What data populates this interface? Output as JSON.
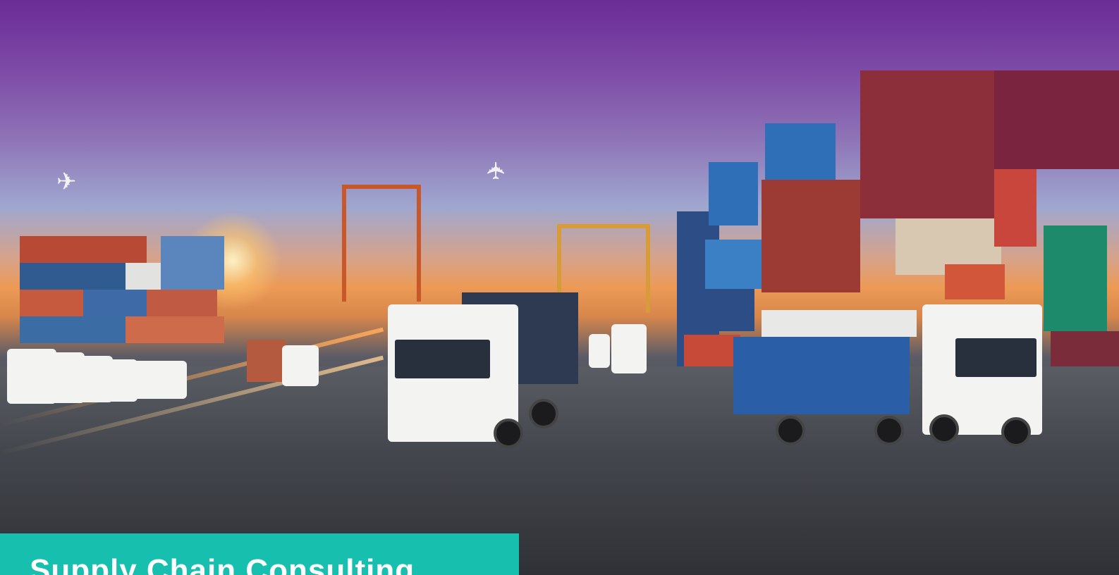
{
  "hero": {
    "image_description_icon": "logistics-port-icon",
    "banner_title": "Supply Chain Consulting"
  },
  "colors": {
    "banner_background": "#16bfae",
    "banner_text": "#ffffff"
  }
}
